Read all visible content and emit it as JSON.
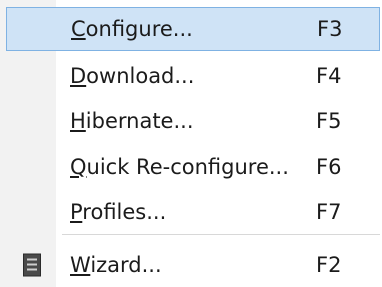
{
  "menu": {
    "items": [
      {
        "pre": "",
        "mnemonic": "C",
        "post": "onfigure...",
        "shortcut": "F3",
        "selected": true
      },
      {
        "pre": "",
        "mnemonic": "D",
        "post": "ownload...",
        "shortcut": "F4"
      },
      {
        "pre": "",
        "mnemonic": "H",
        "post": "ibernate...",
        "shortcut": "F5"
      },
      {
        "pre": "",
        "mnemonic": "Q",
        "post": "uick Re-configure...",
        "shortcut": "F6"
      },
      {
        "pre": "",
        "mnemonic": "P",
        "post": "rofiles...",
        "shortcut": "F7"
      },
      {
        "pre": "",
        "mnemonic": "W",
        "post": "izard...",
        "shortcut": "F2",
        "icon": "wizard-icon"
      }
    ]
  },
  "colors": {
    "selection_fill": "#cfe3f6",
    "selection_border": "#7fb2e3",
    "gutter": "#f2f2f2"
  }
}
